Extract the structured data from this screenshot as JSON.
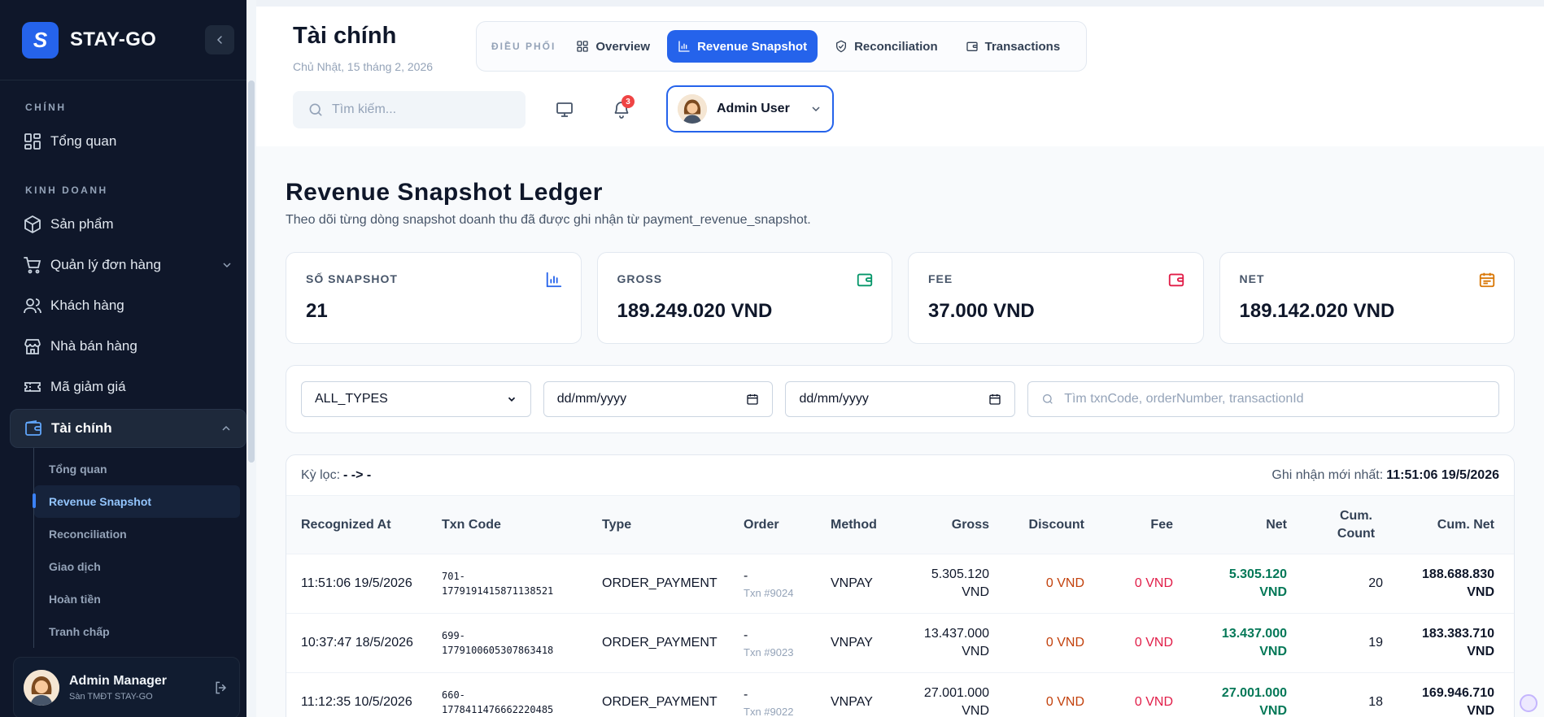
{
  "sidebar": {
    "brand": "STAY-GO",
    "logo_letter": "S",
    "sections": [
      {
        "label": "CHÍNH"
      },
      {
        "label": "KINH DOANH"
      }
    ],
    "items": [
      {
        "label": "Tổng quan",
        "icon": "dashboard-icon"
      },
      {
        "label": "Sản phẩm",
        "icon": "box-icon"
      },
      {
        "label": "Quản lý đơn hàng",
        "icon": "cart-icon"
      },
      {
        "label": "Khách hàng",
        "icon": "users-icon"
      },
      {
        "label": "Nhà bán hàng",
        "icon": "store-icon"
      },
      {
        "label": "Mã giảm giá",
        "icon": "ticket-icon"
      },
      {
        "label": "Tài chính",
        "icon": "wallet-icon"
      }
    ],
    "finance_sub": [
      {
        "label": "Tổng quan"
      },
      {
        "label": "Revenue Snapshot"
      },
      {
        "label": "Reconciliation"
      },
      {
        "label": "Giao dịch"
      },
      {
        "label": "Hoàn tiền"
      },
      {
        "label": "Tranh chấp"
      }
    ],
    "footer": {
      "name": "Admin Manager",
      "subtitle": "Sàn TMĐT STAY-GO"
    }
  },
  "header": {
    "title": "Tài chính",
    "date": "Chủ Nhật, 15 tháng 2, 2026",
    "nav_label": "ĐIỀU PHỐI",
    "tabs": [
      {
        "label": "Overview",
        "icon": "grid-icon"
      },
      {
        "label": "Revenue Snapshot",
        "icon": "bar-chart-icon"
      },
      {
        "label": "Reconciliation",
        "icon": "shield-check-icon"
      },
      {
        "label": "Transactions",
        "icon": "wallet-icon"
      }
    ],
    "search_placeholder": "Tìm kiếm...",
    "notification_count": "3",
    "user": "Admin User"
  },
  "page": {
    "title": "Revenue Snapshot Ledger",
    "subtitle": "Theo dõi từng dòng snapshot doanh thu đã được ghi nhận từ payment_revenue_snapshot."
  },
  "cards": [
    {
      "label": "SỐ SNAPSHOT",
      "value": "21",
      "icon": "bar-chart-icon",
      "color": "#2563eb"
    },
    {
      "label": "GROSS",
      "value": "189.249.020 VND",
      "icon": "wallet-icon",
      "color": "#059669"
    },
    {
      "label": "FEE",
      "value": "37.000 VND",
      "icon": "wallet-icon",
      "color": "#e11d48"
    },
    {
      "label": "NET",
      "value": "189.142.020 VND",
      "icon": "calendar-icon",
      "color": "#d97706"
    }
  ],
  "filters": {
    "type_value": "ALL_TYPES",
    "date_from": "dd/mm/yyyy",
    "date_to": "dd/mm/yyyy",
    "search_placeholder": "Tìm txnCode, orderNumber, transactionId"
  },
  "table": {
    "range_label": "Kỳ lọc:",
    "range_value": "- -> -",
    "latest_label": "Ghi nhận mới nhất:",
    "latest_value": "11:51:06 19/5/2026",
    "columns": [
      "Recognized At",
      "Txn Code",
      "Type",
      "Order",
      "Method",
      "Gross",
      "Discount",
      "Fee",
      "Net",
      "Cum. Count",
      "Cum. Net"
    ],
    "rows": [
      {
        "recognized_at": "11:51:06 19/5/2026",
        "txn_code_1": "701-",
        "txn_code_2": "1779191415871138521",
        "type": "ORDER_PAYMENT",
        "order": "-",
        "order_txn": "Txn #9024",
        "method": "VNPAY",
        "gross_1": "5.305.120",
        "gross_2": "VND",
        "discount": "0 VND",
        "fee": "0 VND",
        "net_1": "5.305.120",
        "net_2": "VND",
        "cum_count": "20",
        "cum_net_1": "188.688.830",
        "cum_net_2": "VND"
      },
      {
        "recognized_at": "10:37:47 18/5/2026",
        "txn_code_1": "699-",
        "txn_code_2": "1779100605307863418",
        "type": "ORDER_PAYMENT",
        "order": "-",
        "order_txn": "Txn #9023",
        "method": "VNPAY",
        "gross_1": "13.437.000",
        "gross_2": "VND",
        "discount": "0 VND",
        "fee": "0 VND",
        "net_1": "13.437.000",
        "net_2": "VND",
        "cum_count": "19",
        "cum_net_1": "183.383.710",
        "cum_net_2": "VND"
      },
      {
        "recognized_at": "11:12:35 10/5/2026",
        "txn_code_1": "660-",
        "txn_code_2": "1778411476662220485",
        "type": "ORDER_PAYMENT",
        "order": "-",
        "order_txn": "Txn #9022",
        "method": "VNPAY",
        "gross_1": "27.001.000",
        "gross_2": "VND",
        "discount": "0 VND",
        "fee": "0 VND",
        "net_1": "27.001.000",
        "net_2": "VND",
        "cum_count": "18",
        "cum_net_1": "169.946.710",
        "cum_net_2": "VND"
      }
    ]
  }
}
